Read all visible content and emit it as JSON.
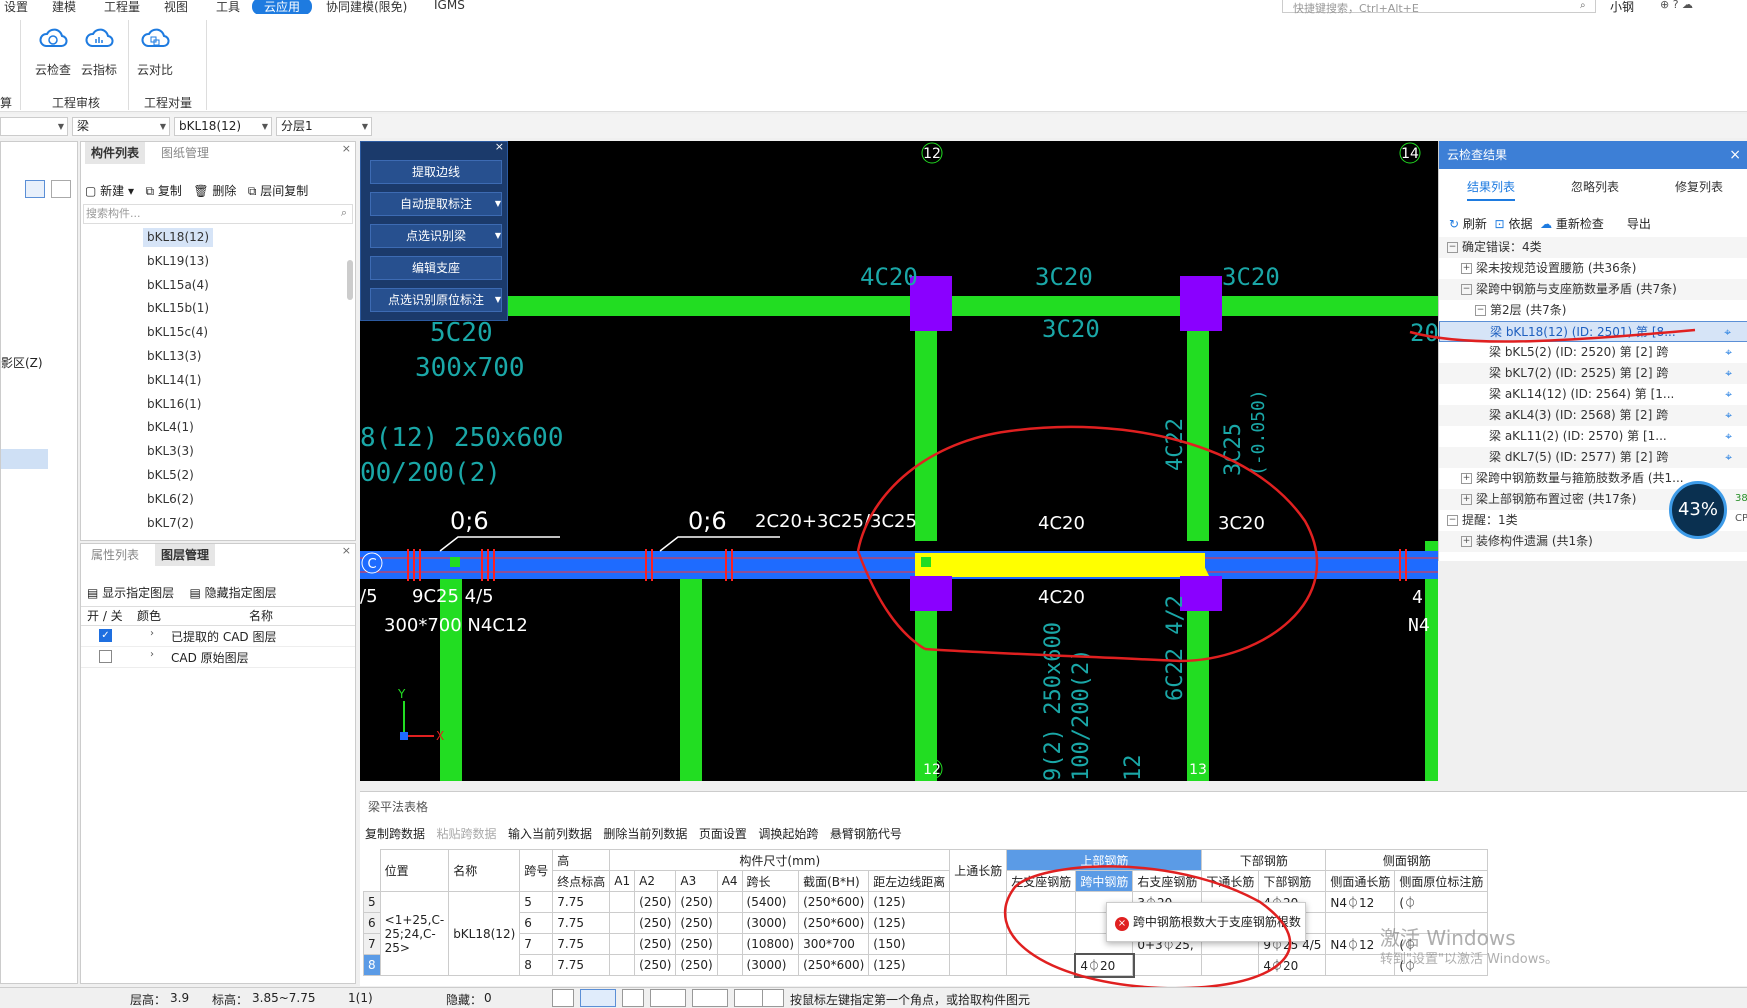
{
  "menu": {
    "items": [
      "设置",
      "建模",
      "工程量",
      "视图",
      "工具",
      "云应用",
      "协同建模(限免)",
      "IGMS"
    ],
    "active": "云应用",
    "search_placeholder": "快捷键搜索，Ctrl+Alt+E",
    "user": "小钢"
  },
  "ribbon": {
    "buttons": [
      "云检查",
      "云指标",
      "云对比"
    ],
    "groups": [
      "算",
      "工程审核",
      "工程对量"
    ]
  },
  "selectors": {
    "type": "梁",
    "element": "bKL18(12)",
    "layer": "分层1"
  },
  "left_panel": {
    "tabs": [
      "构件列表",
      "图纸管理"
    ],
    "toolbar": [
      "新建",
      "复制",
      "删除",
      "层间复制"
    ],
    "search_placeholder": "搜索构件...",
    "items": [
      "bKL18(12)",
      "bKL19(13)",
      "bKL15a(4)",
      "bKL15b(1)",
      "bKL15c(4)",
      "bKL13(3)",
      "bKL14(1)",
      "bKL16(1)",
      "bKL4(1)",
      "bKL3(3)",
      "bKL5(2)",
      "bKL6(2)",
      "bKL7(2)"
    ],
    "selected": "bKL18(12)",
    "side_label": "影区(Z)"
  },
  "layer_panel": {
    "tabs": [
      "属性列表",
      "图层管理"
    ],
    "actions": [
      "显示指定图层",
      "隐藏指定图层"
    ],
    "headers": [
      "开 / 关",
      "颜色",
      "名称"
    ],
    "rows": [
      {
        "checked": true,
        "name": "已提取的 CAD 图层"
      },
      {
        "checked": false,
        "name": "CAD 原始图层"
      }
    ]
  },
  "tool_panel": {
    "buttons": [
      "提取边线",
      "自动提取标注",
      "点选识别梁",
      "编辑支座",
      "点选识别原位标注"
    ]
  },
  "canvas": {
    "axis_labels": [
      "12",
      "14",
      "12",
      "13",
      "C"
    ],
    "texts": [
      "4C20",
      "3C20",
      "3C20",
      "3C20",
      "5C20",
      "300x700",
      "8(12) 250x600",
      "00/200(2)",
      "0;6",
      "0;6",
      "2C20+3C25/3C25",
      "4C20",
      "3C20",
      "4C20",
      "9C25 4/5",
      "300*700 N4C12",
      "/5",
      "4C22",
      "3C25",
      "(-0.050)",
      "6C22 4/2",
      "9(2) 250x600",
      "100/200(2)",
      "12",
      "20",
      "4",
      "N4"
    ]
  },
  "right_panel": {
    "title": "云检查结果",
    "tabs": [
      "结果列表",
      "忽略列表",
      "修复列表"
    ],
    "toolbar": [
      "刷新",
      "依据",
      "重新检查",
      "导出"
    ],
    "tree": [
      {
        "level": 0,
        "expander": "−",
        "text": "确定错误：4类"
      },
      {
        "level": 1,
        "expander": "+",
        "text": "梁未按规范设置腰筋 (共36条)"
      },
      {
        "level": 1,
        "expander": "−",
        "text": "梁跨中钢筋与支座筋数量矛盾 (共7条)"
      },
      {
        "level": 2,
        "expander": "−",
        "text": "第2层 (共7条)"
      },
      {
        "level": 3,
        "expander": "",
        "text": "梁 bKL18(12) (ID: 2501) 第 [8...",
        "highlight": true
      },
      {
        "level": 3,
        "expander": "",
        "text": "梁 bKL5(2) (ID: 2520) 第 [2] 跨"
      },
      {
        "level": 3,
        "expander": "",
        "text": "梁 bKL7(2) (ID: 2525) 第 [2] 跨"
      },
      {
        "level": 3,
        "expander": "",
        "text": "梁 aKL14(12) (ID: 2564) 第 [1..."
      },
      {
        "level": 3,
        "expander": "",
        "text": "梁 aKL4(3) (ID: 2568) 第 [2] 跨"
      },
      {
        "level": 3,
        "expander": "",
        "text": "梁 aKL11(2) (ID: 2570) 第 [1..."
      },
      {
        "level": 3,
        "expander": "",
        "text": "梁 dKL7(5) (ID: 2577) 第 [2] 跨"
      },
      {
        "level": 1,
        "expander": "+",
        "text": "梁跨中钢筋数量与箍筋肢数矛盾 (共1..."
      },
      {
        "level": 1,
        "expander": "+",
        "text": "梁上部钢筋布置过密 (共17条)"
      },
      {
        "level": 0,
        "expander": "−",
        "text": "提醒：1类"
      },
      {
        "level": 1,
        "expander": "+",
        "text": "装修构件遗漏 (共1条)"
      }
    ],
    "progress_text": "43%",
    "progress_value": 43,
    "side_text": "38",
    "side_text2": "CP"
  },
  "bottom": {
    "title": "梁平法表格",
    "toolbar": [
      "复制跨数据",
      "粘贴跨数据",
      "输入当前列数据",
      "删除当前列数据",
      "页面设置",
      "调换起始跨",
      "悬臂钢筋代号"
    ],
    "headers_top": [
      "位置",
      "名称",
      "跨号",
      "高",
      "构件尺寸(mm)",
      "上通长筋",
      "上部钢筋",
      "下部钢筋",
      "侧面钢筋"
    ],
    "headers": [
      "终点标高",
      "A1",
      "A2",
      "A3",
      "A4",
      "跨长",
      "截面(B*H)",
      "距左边线距离",
      "左支座钢筋",
      "跨中钢筋",
      "右支座钢筋",
      "下通长筋",
      "下部钢筋",
      "侧面通长筋",
      "侧面原位标注筋"
    ],
    "position": "<1+25,C-25;24,C-25>",
    "name": "bKL18(12)",
    "rows": [
      {
        "rownum": "5",
        "span": "5",
        "elev": "7.75",
        "a1": "",
        "a2": "(250)",
        "a3": "(250)",
        "a4": "",
        "len": "(5400)",
        "sect": "(250*600)",
        "dist": "(125)",
        "left": "",
        "mid": "",
        "right": "3⏀20",
        "down_long": "",
        "down": "4⏀20",
        "side_long": "N4⏀12",
        "side_note": "(⏀"
      },
      {
        "rownum": "6",
        "span": "6",
        "elev": "7.75",
        "a1": "",
        "a2": "(250)",
        "a3": "(250)",
        "a4": "",
        "len": "(3000)",
        "sect": "(250*600)",
        "dist": "(125)",
        "left": "",
        "mid": "",
        "right": "",
        "down_long": "",
        "down": "4⏀20",
        "side_long": "",
        "side_note": ""
      },
      {
        "rownum": "7",
        "span": "7",
        "elev": "7.75",
        "a1": "",
        "a2": "(250)",
        "a3": "(250)",
        "a4": "",
        "len": "(10800)",
        "sect": "300*700",
        "dist": "(150)",
        "left": "",
        "mid": "",
        "right": "0+3⏀25,",
        "down_long": "",
        "down": "9⏀25 4/5",
        "side_long": "N4⏀12",
        "side_note": "(⏀"
      },
      {
        "rownum": "8",
        "span": "8",
        "elev": "7.75",
        "a1": "",
        "a2": "(250)",
        "a3": "(250)",
        "a4": "",
        "len": "(3000)",
        "sect": "(250*600)",
        "dist": "(125)",
        "left": "",
        "mid": "4⏀20",
        "right": "",
        "down_long": "",
        "down": "4⏀20",
        "side_long": "",
        "side_note": "(⏀"
      }
    ],
    "error_popup": "跨中钢筋根数大于支座钢筋根数",
    "watermark1": "激活 Windows",
    "watermark2": "转到\"设置\"以激活 Windows。"
  },
  "status": {
    "floor_height_label": "层高：",
    "floor_height": "3.9",
    "elev_label": "标高：",
    "elev": "3.85~7.75",
    "count": "1(1)",
    "hidden_label": "隐藏：",
    "hidden": "0",
    "hint": "按鼠标左键指定第一个角点，或拾取构件图元"
  },
  "colors": {
    "accent": "#1e7be0",
    "beam_green": "#22dd22",
    "beam_blue": "#1e6bff",
    "column_purple": "#8a00ff",
    "highlight_yellow": "#ffff00",
    "annotation_red": "#e02020"
  }
}
